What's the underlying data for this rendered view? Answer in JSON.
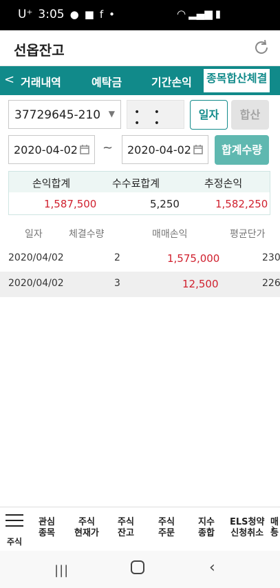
{
  "status_bar": {
    "carrier": "U⁺",
    "time": "3:05",
    "dot": "•"
  },
  "app_title": "선옵잔고",
  "tabs": {
    "back": "<",
    "items": [
      "거래내역",
      "예탁금",
      "기간손익",
      "종목합산체결"
    ]
  },
  "account": {
    "number": "37729645-210",
    "password_mask": "• • • •"
  },
  "buttons": {
    "by_date": "일자",
    "combined": "합산",
    "total_qty": "합계수량"
  },
  "dates": {
    "from": "2020-04-02",
    "separator": "~",
    "to": "2020-04-02"
  },
  "summary": {
    "headers": [
      "손익합계",
      "수수료합계",
      "추정손익"
    ],
    "values": [
      "1,587,500",
      "5,250",
      "1,582,250"
    ]
  },
  "table": {
    "headers": [
      "일자",
      "체결수량",
      "매매손익",
      "평균단가"
    ],
    "rows": [
      {
        "date": "2020/04/02",
        "qty": "2",
        "pl": "1,575,000",
        "avg": "230"
      },
      {
        "date": "2020/04/02",
        "qty": "3",
        "pl": "12,500",
        "avg": "226"
      }
    ]
  },
  "bottom_nav": {
    "menu_label": "주식",
    "items": [
      {
        "line1": "관심",
        "line2": "종목"
      },
      {
        "line1": "주식",
        "line2": "현재가"
      },
      {
        "line1": "주식",
        "line2": "잔고"
      },
      {
        "line1": "주식",
        "line2": "주문"
      },
      {
        "line1": "지수",
        "line2": "종합"
      },
      {
        "line1": "ELS청약",
        "line2": "신청취소"
      },
      {
        "line1": "매",
        "line2": "등"
      }
    ]
  },
  "colors": {
    "accent": "#118a8a",
    "red": "#d0202e"
  }
}
